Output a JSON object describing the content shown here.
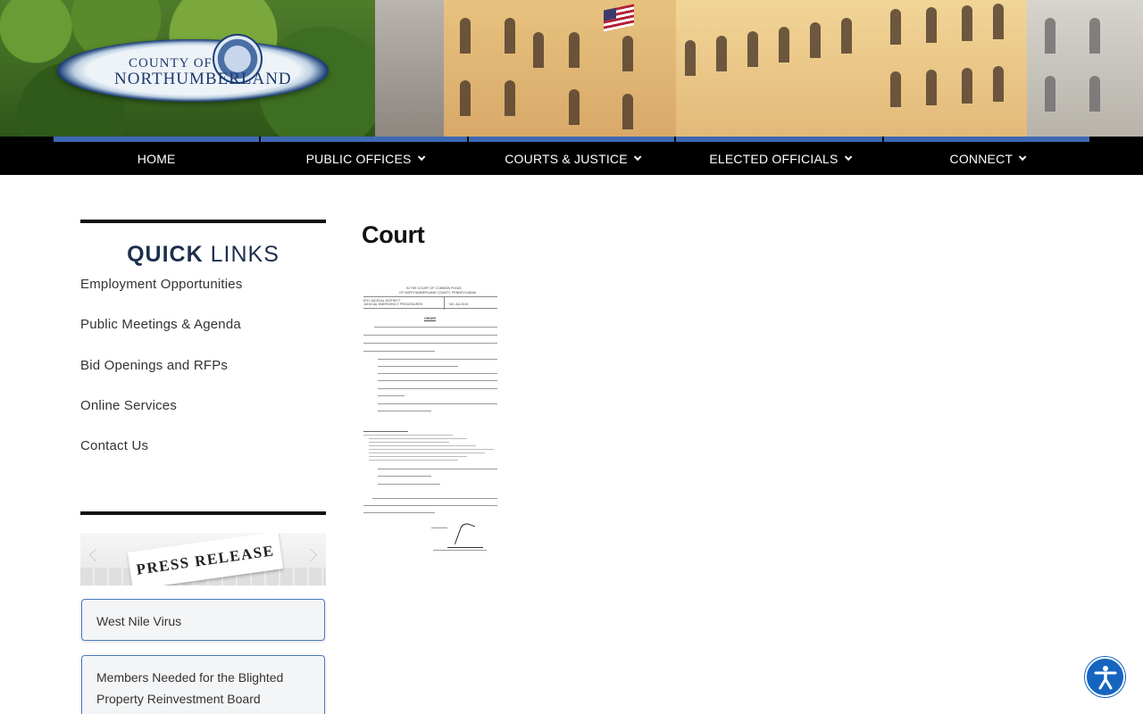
{
  "header": {
    "logo_line1": "COUNTY OF",
    "logo_line2": "NORTHUMBERLAND"
  },
  "nav": {
    "items": [
      {
        "label": "HOME",
        "has_dropdown": false
      },
      {
        "label": "PUBLIC OFFICES",
        "has_dropdown": true
      },
      {
        "label": "COURTS & JUSTICE",
        "has_dropdown": true
      },
      {
        "label": "ELECTED OFFICIALS",
        "has_dropdown": true
      },
      {
        "label": "CONNECT",
        "has_dropdown": true
      }
    ],
    "accent_color": "#3e68b3"
  },
  "sidebar": {
    "quick_links_bold": "QUICK",
    "quick_links_light": "LINKS",
    "links": [
      "Employment Opportunities",
      "Public Meetings & Agenda",
      "Bid Openings and RFPs",
      "Online Services",
      "Contact Us"
    ],
    "press_banner_text": "PRESS RELEASE",
    "news": [
      "West Nile Virus",
      "Members Needed for the Blighted Property Reinvestment Board"
    ]
  },
  "main": {
    "title": "Court"
  },
  "document": {
    "heading1": "IN THE COURT OF COMMON PLEAS",
    "heading2": "OF NORTHUMBERLAND COUNTY, PENNSYLVANIA",
    "district": "8TH JUDICIAL DISTRICT",
    "subject": "JUDICIAL EMERGENCY PROCEDURES",
    "number": "NO. AD-2019",
    "order_title": "ORDER"
  },
  "icons": {
    "dropdown": "chevron-down-icon",
    "accessibility": "accessibility-icon"
  }
}
